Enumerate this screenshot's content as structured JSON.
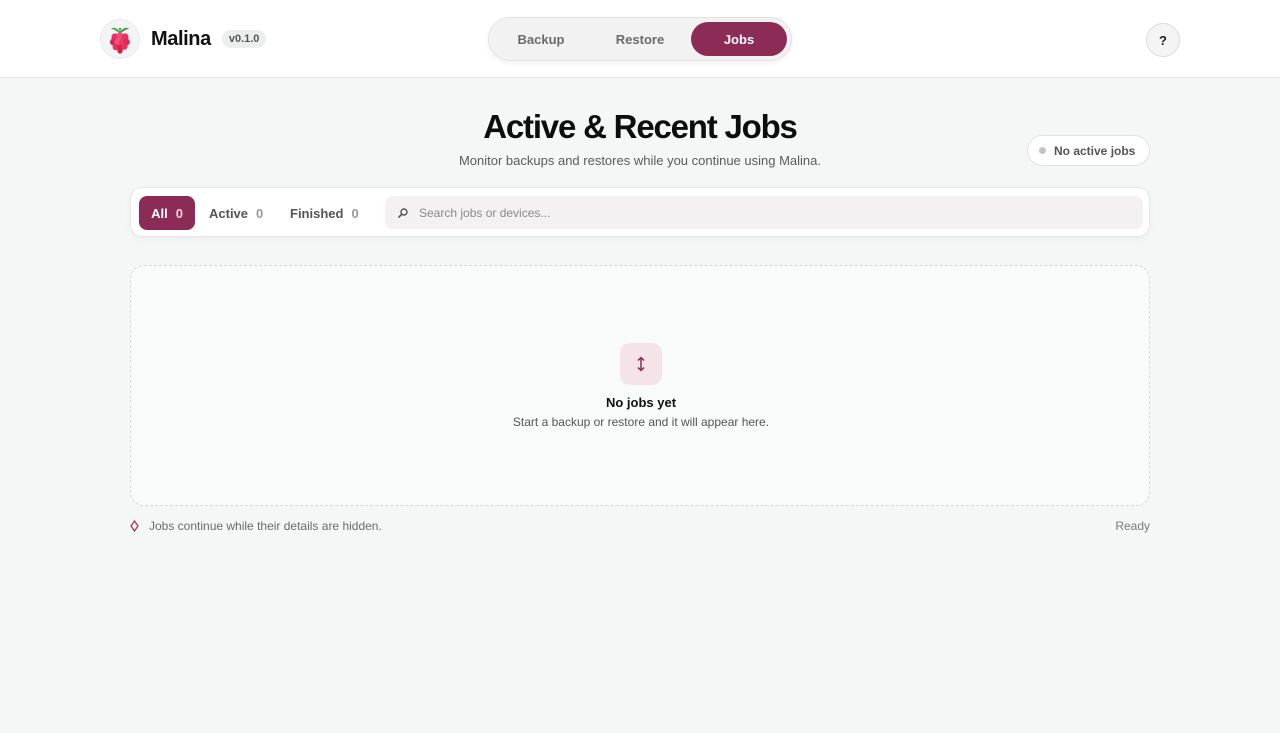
{
  "header": {
    "app_name": "Malina",
    "version": "v0.1.0",
    "logo_icon": "raspberry-icon",
    "nav": [
      {
        "label": "Backup",
        "selected": false
      },
      {
        "label": "Restore",
        "selected": false
      },
      {
        "label": "Jobs",
        "selected": true
      }
    ],
    "help_label": "?"
  },
  "main": {
    "title": "Active & Recent Jobs",
    "subtitle": "Monitor backups and restores while you continue using Malina.",
    "status_pill": "No active jobs",
    "filters": [
      {
        "label": "All",
        "count": "0",
        "selected": true
      },
      {
        "label": "Active",
        "count": "0",
        "selected": false
      },
      {
        "label": "Finished",
        "count": "0",
        "selected": false
      }
    ],
    "search": {
      "placeholder": "Search jobs or devices...",
      "value": "",
      "icon": "search-icon"
    },
    "empty": {
      "icon": "up-down-arrow-icon",
      "title": "No jobs yet",
      "subtitle": "Start a backup or restore and it will appear here."
    }
  },
  "footer": {
    "note_icon": "diamond-icon",
    "note": "Jobs continue while their details are hidden.",
    "status": "Ready"
  },
  "colors": {
    "accent": "#8c2b55",
    "background": "#f4f7f6",
    "surface": "#ffffff",
    "empty_icon_bg": "#f5e3ea"
  }
}
